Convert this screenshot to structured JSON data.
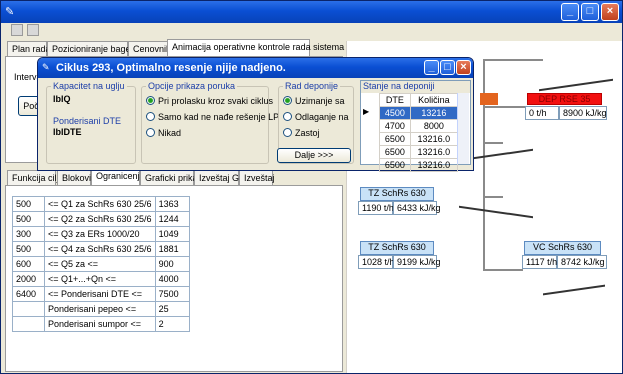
{
  "main_tabs": [
    "Plan rada",
    "Pozicioniranje bagera",
    "Cenovnik",
    "Animacija operativne kontrole rada sistema"
  ],
  "left_labels": {
    "interval": "Interva",
    "button": "Poč"
  },
  "lower_tabs": [
    "Funkcija cilja",
    "Blokovi",
    "Ogranicenja",
    "Graficki prikaz",
    "Izveštaj Graf",
    "Izveštaj"
  ],
  "constraints": [
    [
      "500",
      "<= Q1 za SchRs 630 25/6",
      "1363"
    ],
    [
      "500",
      "<= Q2 za SchRs 630 25/6",
      "1244"
    ],
    [
      "300",
      "<= Q3 za ERs 1000/20",
      "1049"
    ],
    [
      "500",
      "<= Q4 za SchRs 630 25/6",
      "1881"
    ],
    [
      "600",
      "<= Q5 za <=",
      "900"
    ],
    [
      "2000",
      "<= Q1+...+Qn <=",
      "4000"
    ],
    [
      "6400",
      "<= Ponderisani DTE <=",
      "7500"
    ],
    [
      "",
      "Ponderisani pepeo <=",
      "25"
    ],
    [
      "",
      "Ponderisani sumpor <=",
      "2"
    ]
  ],
  "diagram": {
    "dep": {
      "label": "DEP RSE 35",
      "rate": "0 t/h",
      "energy": "8900 kJ/kg"
    },
    "tz1": {
      "label": "TZ SchRs 630",
      "rate": "1190 t/h",
      "energy": "6433 kJ/kg"
    },
    "tz2": {
      "label": "TZ SchRs 630",
      "rate": "1028 t/h",
      "energy": "9199 kJ/kg"
    },
    "vc": {
      "label": "VC SchRs 630",
      "rate": "1117 t/h",
      "energy": "8742 kJ/kg"
    }
  },
  "dialog": {
    "title": "Ciklus 293, Optimalno resenje njije nadjeno.",
    "kapacitet_label": "Kapacitet na uglju",
    "kapacitet_value": "lblQ",
    "dte_label": "Ponderisani DTE",
    "dte_value": "lblDTE",
    "opcije_label": "Opcije prikaza poruka",
    "opcije": [
      "Pri prolasku kroz svaki ciklus",
      "Samo kad ne nađe rešenje LP",
      "Nikad"
    ],
    "rad_label": "Rad deponije",
    "rad": [
      "Uzimanje sa",
      "Odlaganje na",
      "Zastoj"
    ],
    "stanje_label": "Stanje na deponiji",
    "grid_headers": [
      "DTE",
      "Količina"
    ],
    "grid_rows": [
      [
        "4500",
        "13216"
      ],
      [
        "4700",
        "8000"
      ],
      [
        "6500",
        "13216.0"
      ],
      [
        "6500",
        "13216.0"
      ],
      [
        "6500",
        "13216.0"
      ]
    ],
    "dalje": "Dalje >>>"
  }
}
